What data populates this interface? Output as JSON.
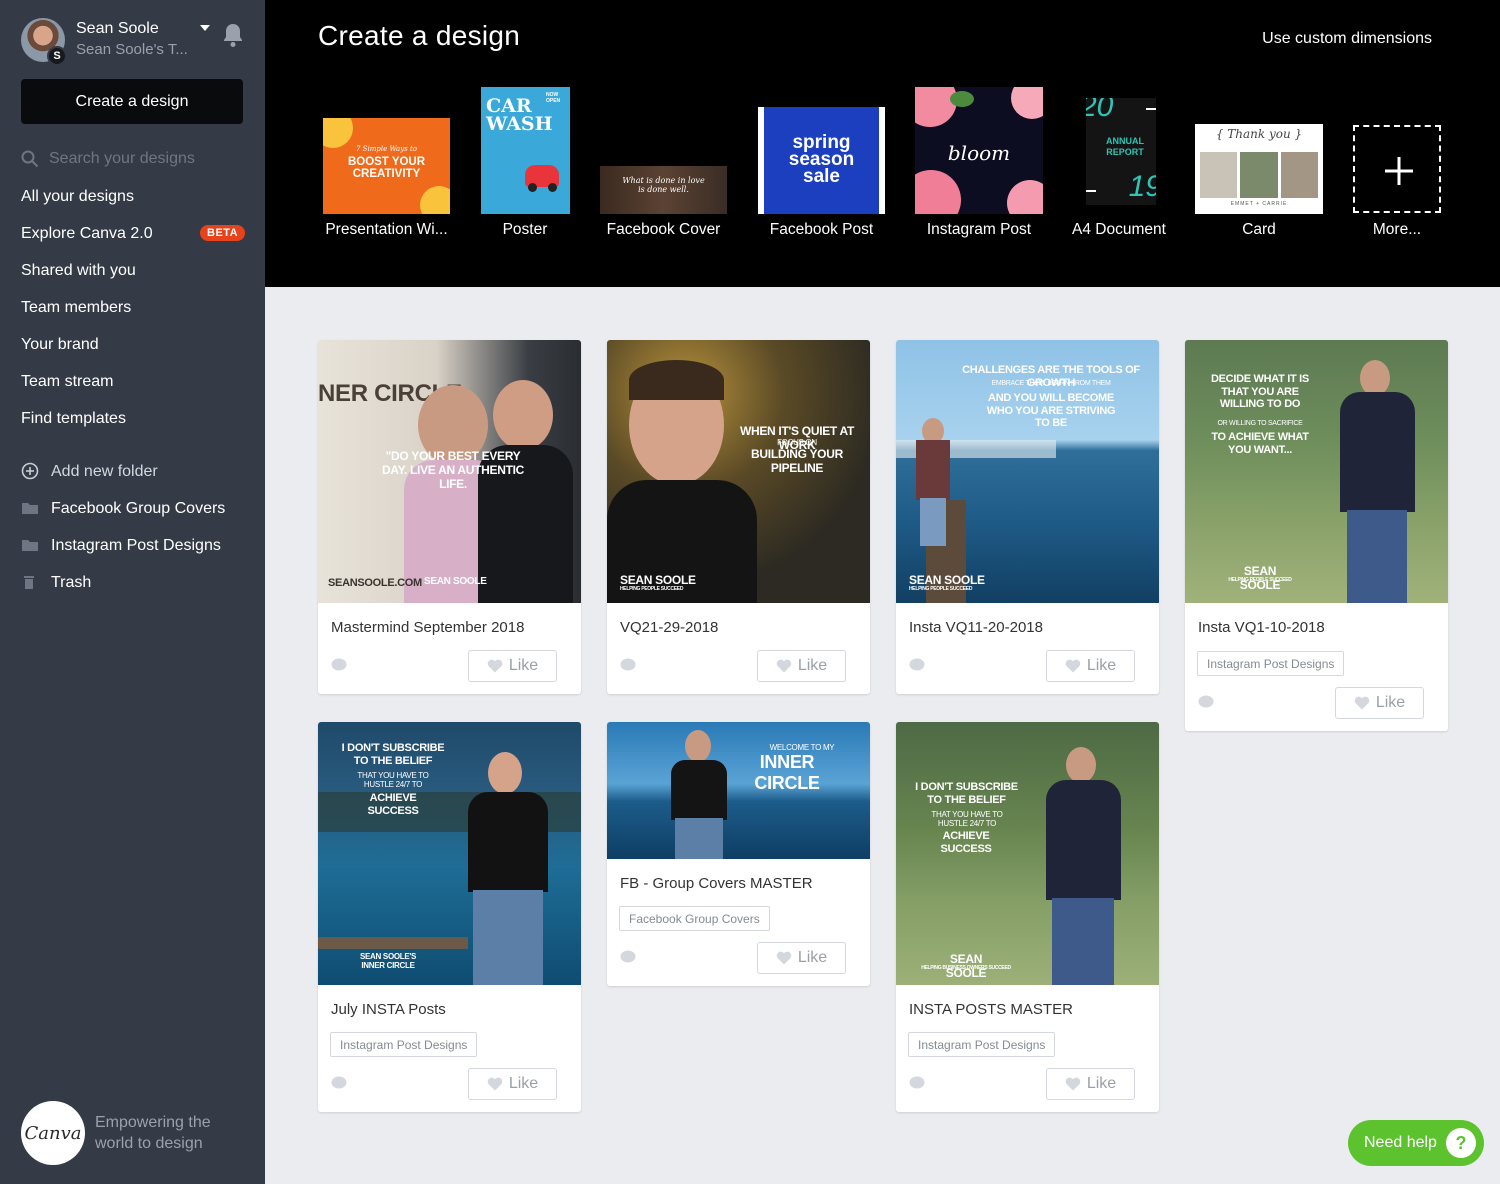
{
  "user": {
    "name": "Sean Soole",
    "team": "Sean Soole's T...",
    "avatar_initial": "S"
  },
  "sidebar": {
    "create_label": "Create a design",
    "search_placeholder": "Search your designs",
    "nav": [
      {
        "label": "All your designs",
        "active": true
      },
      {
        "label": "Explore Canva 2.0",
        "badge": "BETA"
      },
      {
        "label": "Shared with you"
      },
      {
        "label": "Team members"
      },
      {
        "label": "Your brand"
      },
      {
        "label": "Team stream"
      },
      {
        "label": "Find templates"
      }
    ],
    "add_folder_label": "Add new folder",
    "folders": [
      {
        "label": "Facebook Group Covers",
        "icon": "folder-icon"
      },
      {
        "label": "Instagram Post Designs",
        "icon": "folder-icon"
      },
      {
        "label": "Trash",
        "icon": "trash-icon"
      }
    ],
    "footer": {
      "logo_text": "Canva",
      "tagline": "Empowering the world to design"
    }
  },
  "topbar": {
    "title": "Create a design",
    "custom_dimensions": "Use custom dimensions",
    "types": [
      {
        "label": "Presentation Wi...",
        "thumb_text": "BOOST YOUR CREATIVITY",
        "thumb_subtext": "7 Simple Ways to"
      },
      {
        "label": "Poster",
        "thumb_text": "CAR WASH",
        "thumb_subtext": "NOW OPEN"
      },
      {
        "label": "Facebook Cover",
        "thumb_text": "What is done in love is done well."
      },
      {
        "label": "Facebook Post",
        "thumb_text": "spring season sale"
      },
      {
        "label": "Instagram Post",
        "thumb_text": "bloom"
      },
      {
        "label": "A4 Document",
        "thumb_text": "ANNUAL REPORT",
        "year_top": "20",
        "year_bottom": "19"
      },
      {
        "label": "Card",
        "thumb_text": "{ Thank you }",
        "thumb_subtext": "EMMET + CARRIE"
      },
      {
        "label": "More..."
      }
    ]
  },
  "designs": [
    {
      "title": "Mastermind September 2018",
      "overlay_main": "\"DO YOUR BEST EVERY DAY. LIVE AN AUTHENTIC LIFE.",
      "overlay_top": "NER CIRCLE",
      "overlay_bottom": "SEANSOOLE.COM",
      "brand": "SEAN SOOLE",
      "like": "Like"
    },
    {
      "title": "VQ21-29-2018",
      "overlay_main": "WHEN IT'S QUIET AT WORK",
      "overlay_sub": "FOCUS ON",
      "overlay_main2": "BUILDING YOUR PIPELINE",
      "brand": "SEAN SOOLE",
      "brand_sub": "HELPING PEOPLE SUCCEED",
      "like": "Like"
    },
    {
      "title": "Insta VQ11-20-2018",
      "overlay_main": "CHALLENGES ARE THE TOOLS OF GROWTH",
      "overlay_sub": "EMBRACE THEM. LEARN FROM THEM",
      "overlay_main2": "AND YOU WILL BECOME WHO YOU ARE STRIVING TO BE",
      "brand": "SEAN SOOLE",
      "brand_sub": "HELPING PEOPLE SUCCEED",
      "like": "Like"
    },
    {
      "title": "Insta VQ1-10-2018",
      "tag": "Instagram Post Designs",
      "overlay_main": "DECIDE WHAT IT IS THAT YOU ARE WILLING TO DO",
      "overlay_sub": "OR WILLING TO SACRIFICE",
      "overlay_main2": "TO ACHIEVE WHAT YOU WANT...",
      "brand": "SEAN SOOLE",
      "brand_sub": "HELPING PEOPLE SUCCEED",
      "like": "Like"
    },
    {
      "title": "July INSTA Posts",
      "tag": "Instagram Post Designs",
      "overlay_main": "I DON'T SUBSCRIBE TO THE BELIEF",
      "overlay_sub": "THAT YOU HAVE TO HUSTLE 24/7 TO",
      "overlay_main2": "ACHIEVE SUCCESS",
      "brand": "SEAN SOOLE'S INNER CIRCLE",
      "like": "Like"
    },
    {
      "title": "FB - Group Covers MASTER",
      "tag": "Facebook Group Covers",
      "overlay_sub": "WELCOME TO MY",
      "overlay_main": "INNER CIRCLE",
      "like": "Like"
    },
    {
      "title": "INSTA POSTS MASTER",
      "tag": "Instagram Post Designs",
      "overlay_main": "I DON'T SUBSCRIBE TO THE BELIEF",
      "overlay_sub": "THAT YOU HAVE TO HUSTLE 24/7 TO",
      "overlay_main2": "ACHIEVE SUCCESS",
      "brand": "SEAN SOOLE",
      "brand_sub": "HELPING BUSINESS OWNERS SUCCEED",
      "like": "Like"
    }
  ],
  "help": {
    "label": "Need help",
    "icon_text": "?"
  },
  "colors": {
    "sidebar_bg": "#343b47",
    "topbar_bg": "#000000",
    "canvas_bg": "#ebecf0",
    "beta_badge": "#e8421c",
    "help_button": "#5cc22e",
    "a4_accent": "#2ec4b6"
  }
}
